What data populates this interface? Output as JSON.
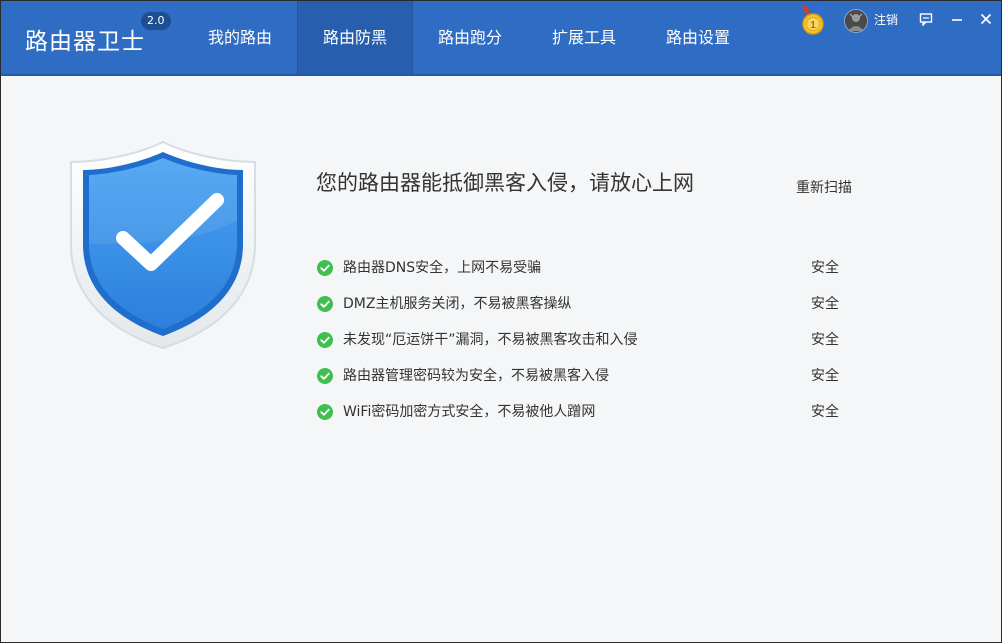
{
  "app": {
    "title": "路由器卫士",
    "version": "2.0"
  },
  "nav": {
    "tabs": [
      {
        "label": "我的路由"
      },
      {
        "label": "路由防黑",
        "active": true
      },
      {
        "label": "路由跑分"
      },
      {
        "label": "扩展工具"
      },
      {
        "label": "路由设置"
      }
    ]
  },
  "header": {
    "logout_label": "注销",
    "icons": [
      "medal-icon",
      "avatar",
      "feedback-icon",
      "minimize-icon",
      "close-icon"
    ]
  },
  "main": {
    "headline": "您的路由器能抵御黑客入侵，请放心上网",
    "rescan_label": "重新扫描",
    "checks": [
      {
        "text": "路由器DNS安全，上网不易受骗",
        "status": "安全"
      },
      {
        "text": "DMZ主机服务关闭，不易被黑客操纵",
        "status": "安全"
      },
      {
        "text": "未发现“厄运饼干”漏洞，不易被黑客攻击和入侵",
        "status": "安全"
      },
      {
        "text": "路由器管理密码较为安全，不易被黑客入侵",
        "status": "安全"
      },
      {
        "text": "WiFi密码加密方式安全，不易被他人蹭网",
        "status": "安全"
      }
    ]
  },
  "colors": {
    "header_bg": "#2f6dc4",
    "active_tab_bg": "#275fae",
    "content_bg": "#f4f6f7",
    "shield_blue": "#3d8fe6",
    "check_green": "#3fbf4f"
  }
}
